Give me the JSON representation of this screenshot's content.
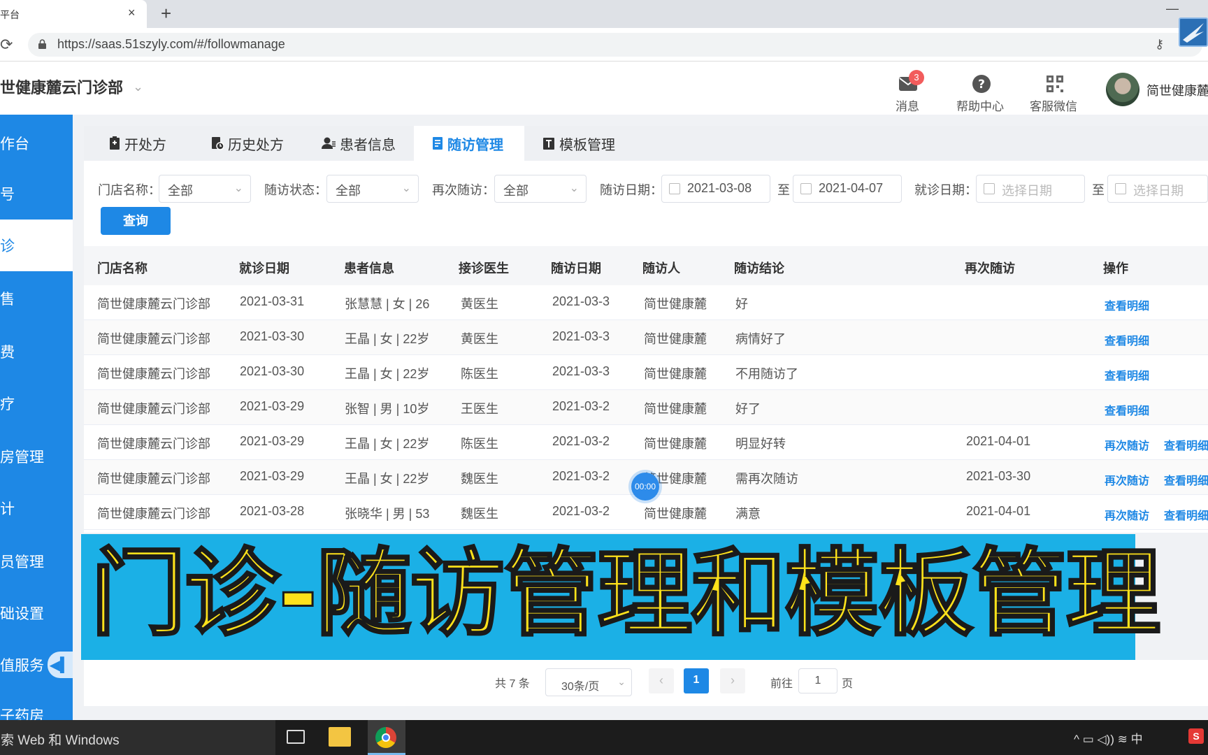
{
  "browser": {
    "tab_title": "医疗平台",
    "tab_close": "×",
    "new_tab": "+",
    "minimize": "—",
    "url": "https://saas.51szyly.com/#/followmanage"
  },
  "header": {
    "brand": "简世健康麓云门诊部",
    "messages_label": "消息",
    "messages_badge": "3",
    "help_label": "帮助中心",
    "wechat_label": "客服微信",
    "username": "简世健康麓"
  },
  "sidebar": {
    "items": [
      {
        "label": "工作台"
      },
      {
        "label": "挂号"
      },
      {
        "label": "门诊"
      },
      {
        "label": "药售"
      },
      {
        "label": "收费"
      },
      {
        "label": "治疗"
      },
      {
        "label": "库房管理"
      },
      {
        "label": "统计"
      },
      {
        "label": "会员管理"
      },
      {
        "label": "基础设置"
      },
      {
        "label": "增值服务"
      },
      {
        "label": "电子药房"
      }
    ],
    "active_index": 2
  },
  "tabs": [
    {
      "label": "开处方",
      "icon": "prescription-icon"
    },
    {
      "label": "历史处方",
      "icon": "history-icon"
    },
    {
      "label": "患者信息",
      "icon": "patient-icon"
    },
    {
      "label": "随访管理",
      "icon": "followup-icon"
    },
    {
      "label": "模板管理",
      "icon": "template-icon"
    }
  ],
  "filters": {
    "store_label": "门店名称：",
    "store_value": "全部",
    "status_label": "随访状态：",
    "status_value": "全部",
    "revisit_label": "再次随访：",
    "revisit_value": "全部",
    "follow_date_label": "随访日期：",
    "follow_date_from": "2021-03-08",
    "follow_date_to": "2021-04-07",
    "visit_date_label": "就诊日期：",
    "visit_date_placeholder_from": "选择日期",
    "visit_date_placeholder_to": "选择日期",
    "to_sep": "至",
    "query_button": "查询"
  },
  "table": {
    "headers": [
      "门店名称",
      "就诊日期",
      "患者信息",
      "接诊医生",
      "随访日期",
      "随访人",
      "随访结论",
      "再次随访",
      "操作"
    ],
    "rows": [
      {
        "store": "简世健康麓云门诊部",
        "visit_date": "2021-03-31",
        "patient": "张慧慧 | 女 | 26",
        "doctor": "黄医生",
        "follow_date": "2021-03-3",
        "follower": "简世健康麓",
        "conclusion": "好",
        "revisit": "",
        "actions": [
          "查看明细"
        ]
      },
      {
        "store": "简世健康麓云门诊部",
        "visit_date": "2021-03-30",
        "patient": "王晶 | 女 | 22岁",
        "doctor": "黄医生",
        "follow_date": "2021-03-3",
        "follower": "简世健康麓",
        "conclusion": "病情好了",
        "revisit": "",
        "actions": [
          "查看明细"
        ]
      },
      {
        "store": "简世健康麓云门诊部",
        "visit_date": "2021-03-30",
        "patient": "王晶 | 女 | 22岁",
        "doctor": "陈医生",
        "follow_date": "2021-03-3",
        "follower": "简世健康麓",
        "conclusion": "不用随访了",
        "revisit": "",
        "actions": [
          "查看明细"
        ]
      },
      {
        "store": "简世健康麓云门诊部",
        "visit_date": "2021-03-29",
        "patient": "张智 | 男 | 10岁",
        "doctor": "王医生",
        "follow_date": "2021-03-2",
        "follower": "简世健康麓",
        "conclusion": "好了",
        "revisit": "",
        "actions": [
          "查看明细"
        ]
      },
      {
        "store": "简世健康麓云门诊部",
        "visit_date": "2021-03-29",
        "patient": "王晶 | 女 | 22岁",
        "doctor": "陈医生",
        "follow_date": "2021-03-2",
        "follower": "简世健康麓",
        "conclusion": "明显好转",
        "revisit": "2021-04-01",
        "actions": [
          "再次随访",
          "查看明细"
        ]
      },
      {
        "store": "简世健康麓云门诊部",
        "visit_date": "2021-03-29",
        "patient": "王晶 | 女 | 22岁",
        "doctor": "魏医生",
        "follow_date": "2021-03-2",
        "follower": "简世健康麓",
        "conclusion": "需再次随访",
        "revisit": "2021-03-30",
        "actions": [
          "再次随访",
          "查看明细"
        ]
      },
      {
        "store": "简世健康麓云门诊部",
        "visit_date": "2021-03-28",
        "patient": "张晓华 | 男 | 53",
        "doctor": "魏医生",
        "follow_date": "2021-03-2",
        "follower": "简世健康麓",
        "conclusion": "满意",
        "revisit": "2021-04-01",
        "actions": [
          "再次随访",
          "查看明细"
        ]
      }
    ]
  },
  "recording_timer": "00:00",
  "banner": {
    "text": "门诊-随访管理和模板管理",
    "background": "#1bb0e6",
    "color": "#ffe21a"
  },
  "pagination": {
    "total": "共 7 条",
    "page_size": "30条/页",
    "prev": "‹",
    "current_page": "1",
    "next": "›",
    "goto_label": "前往",
    "goto_value": "1",
    "page_unit": "页"
  },
  "taskbar": {
    "search_text": "搜索 Web 和 Windows",
    "tray_text": "^ ▭ ◁)) ≋ 中",
    "ime_label": "S"
  },
  "colors": {
    "accent": "#1e88e5",
    "sidebar": "#1e88e5",
    "badge": "#f25c5c"
  }
}
